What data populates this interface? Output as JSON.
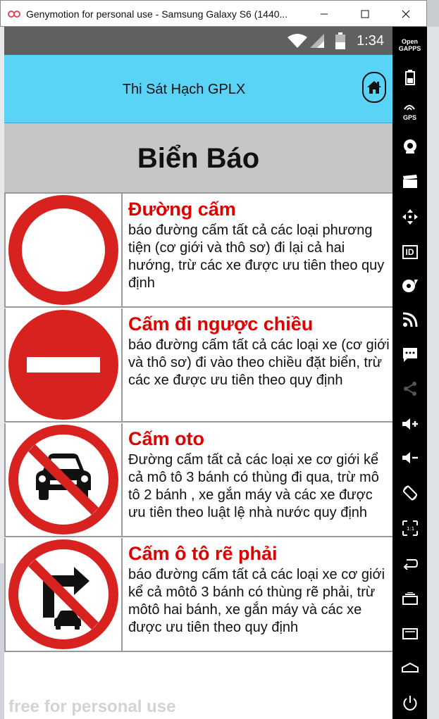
{
  "window": {
    "title": "Genymotion for personal use - Samsung Galaxy S6 (1440...",
    "minimize_icon": "minimize-icon",
    "maximize_icon": "maximize-icon",
    "close_icon": "close-icon"
  },
  "status_bar": {
    "time": "1:34"
  },
  "app_bar": {
    "title": "Thi Sát Hạch GPLX"
  },
  "section": {
    "title": "Biển Báo"
  },
  "signs": [
    {
      "title": "Đường cấm",
      "description": "báo đường cấm tất cả các loại phương tiện (cơ giới và thô sơ) đi lại cả hai hướng, trừ các xe được ưu tiên theo quy định"
    },
    {
      "title": "Cấm đi ngược chiều",
      "description": "báo đường cấm tất cả các loại xe (cơ giới và thô sơ) đi vào theo chiều đặt biển, trừ các xe được ưu tiên theo quy định"
    },
    {
      "title": "Cấm oto",
      "description": "Đường cấm tất cả các loại xe cơ giới kể cả mô tô 3 bánh có thùng đi qua, trừ mô tô 2 bánh , xe gắn máy và các xe được ưu tiên theo luật lệ nhà nước quy định"
    },
    {
      "title": "Cấm ô tô rẽ phải",
      "description": " báo đường cấm tất cả các loại xe cơ giới kể cả môtô 3 bánh có thùng rẽ phải, trừ môtô hai bánh, xe gắn máy và các xe được ưu tiên theo quy định"
    }
  ],
  "watermark": "free for personal use",
  "sidebar": {
    "open_gapps": "Open GAPPS",
    "gps": "GPS",
    "id": "ID"
  },
  "colors": {
    "app_bar": "#5ad4f6",
    "sign_red": "#d8221f",
    "title_red": "#e00000"
  }
}
